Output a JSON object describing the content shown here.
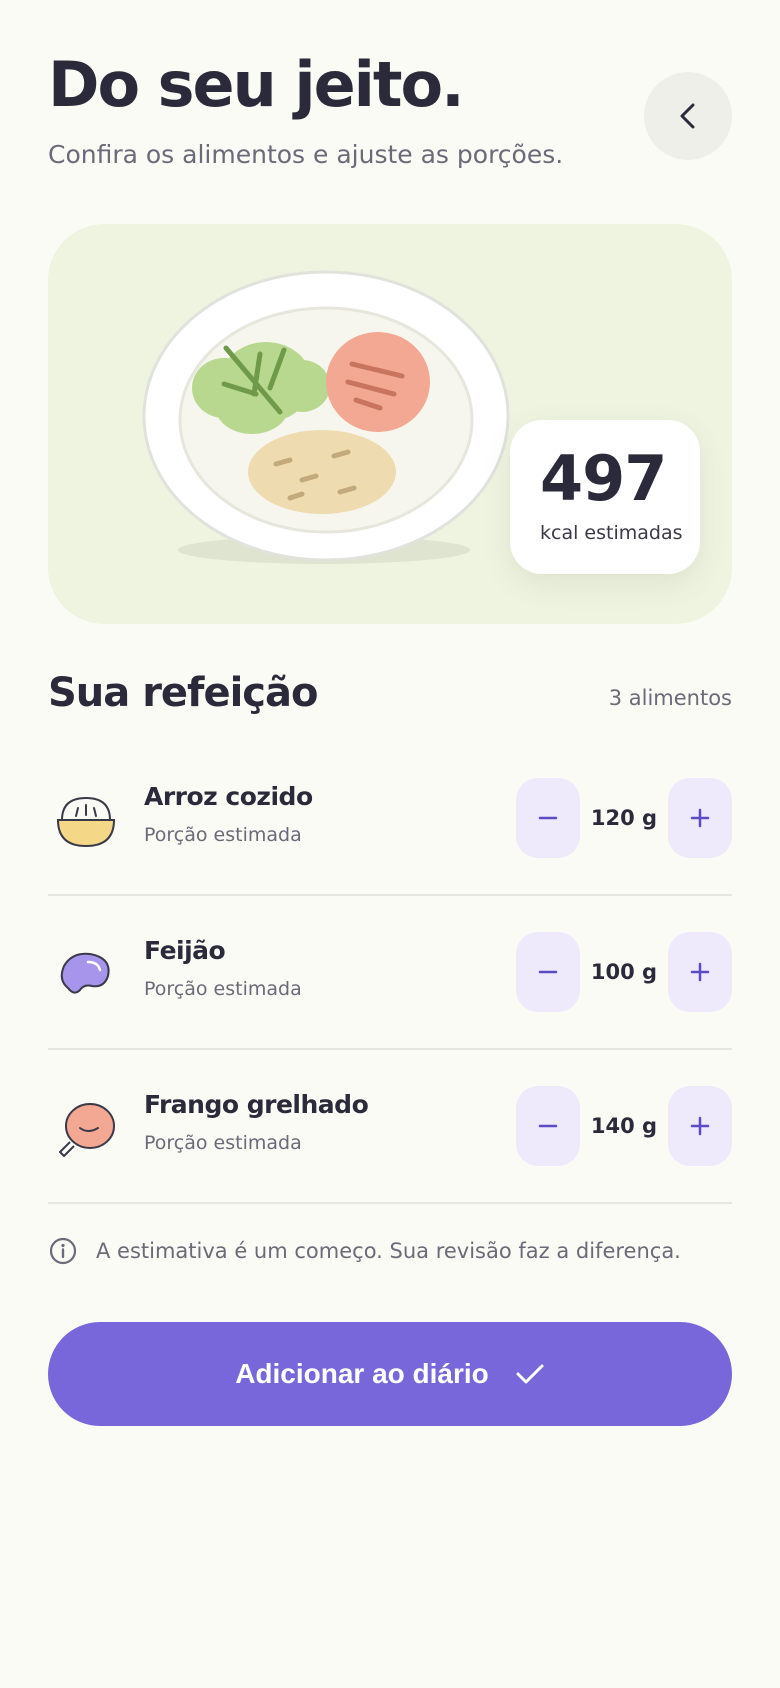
{
  "header": {
    "title": "Do seu jeito.",
    "subtitle": "Confira os alimentos e ajuste as porções."
  },
  "hero": {
    "kcal_value": "497",
    "kcal_label": "kcal estimadas"
  },
  "meal": {
    "title": "Sua refeição",
    "count": "3 alimentos",
    "items": [
      {
        "name": "Arroz cozido",
        "subtitle": "Porção estimada",
        "portion": "120 g",
        "icon": "rice-bowl-icon"
      },
      {
        "name": "Feijão",
        "subtitle": "Porção estimada",
        "portion": "100 g",
        "icon": "bean-icon"
      },
      {
        "name": "Frango grelhado",
        "subtitle": "Porção estimada",
        "portion": "140 g",
        "icon": "chicken-leg-icon"
      }
    ]
  },
  "info": {
    "text": "A estimativa é um começo. Sua revisão faz a diferença.",
    "icon": "info-icon"
  },
  "cta": {
    "label": "Adicionar ao diário",
    "icon": "check-icon"
  },
  "colors": {
    "background": "#fbfbf6",
    "accent": "#7767db",
    "stepper_bg": "#eeeafb",
    "hero_bg": "#eef4e0"
  }
}
